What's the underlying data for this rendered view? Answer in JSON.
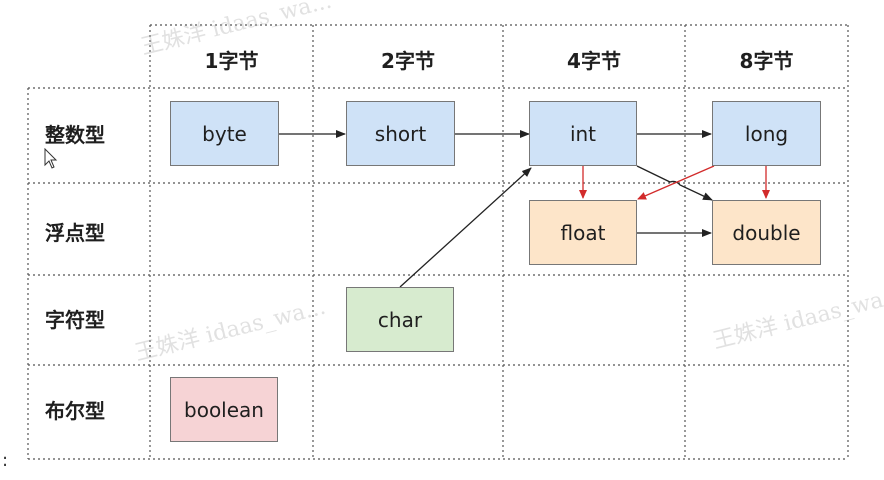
{
  "columns": [
    "1字节",
    "2字节",
    "4字节",
    "8字节"
  ],
  "rows": [
    "整数型",
    "浮点型",
    "字符型",
    "布尔型"
  ],
  "types": {
    "byte": "byte",
    "short": "short",
    "int": "int",
    "long": "long",
    "float": "float",
    "double": "double",
    "char": "char",
    "boolean": "boolean"
  },
  "watermarks": [
    "王姝洋 idaas_wa...",
    "王姝洋 idaas_wa...",
    "王姝洋 idaas_wa..."
  ],
  "stray_text": ":",
  "colors": {
    "integer_fill": "#cfe2f7",
    "float_fill": "#fde5c9",
    "char_fill": "#d7ebcf",
    "boolean_fill": "#f6d3d5",
    "lossless_arrow": "#222222",
    "lossy_arrow": "#d22b2b"
  },
  "icons": [
    "mouse-pointer-icon"
  ]
}
